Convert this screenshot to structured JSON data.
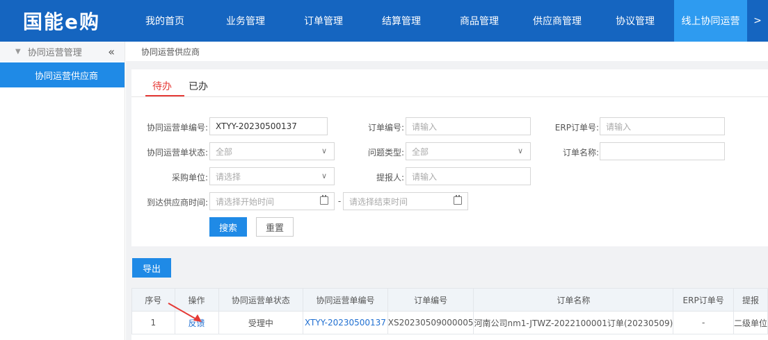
{
  "brand": {
    "logo_text": "国能e购"
  },
  "nav": {
    "items": [
      "我的首页",
      "业务管理",
      "订单管理",
      "结算管理",
      "商品管理",
      "供应商管理",
      "协议管理",
      "线上协同运营"
    ],
    "more": ">"
  },
  "sidebar": {
    "group_label": "协同运营管理",
    "collapse_icon": "«",
    "item": "协同运营供应商"
  },
  "breadcrumb": "协同运营供应商",
  "tabs": [
    "待办",
    "已办"
  ],
  "form": {
    "order_no_label": "协同运营单编号:",
    "order_no_value": "XTYY-20230500137",
    "order_id_label": "订单编号:",
    "order_id_placeholder": "请输入",
    "erp_label": "ERP订单号:",
    "erp_placeholder": "请输入",
    "status_label": "协同运营单状态:",
    "status_value": "全部",
    "issue_label": "问题类型:",
    "issue_value": "全部",
    "order_name_label": "订单名称:",
    "buyer_label": "采购单位:",
    "buyer_placeholder": "请选择",
    "reporter_label": "提报人:",
    "reporter_placeholder": "请输入",
    "arrive_label": "到达供应商时间:",
    "start_placeholder": "请选择开始时间",
    "range_sep": "-",
    "end_placeholder": "请选择结束时间",
    "search_btn": "搜索",
    "reset_btn": "重置"
  },
  "export_btn": "导出",
  "table": {
    "headers": [
      "序号",
      "操作",
      "协同运营单状态",
      "协同运营单编号",
      "订单编号",
      "订单名称",
      "ERP订单号",
      "提报"
    ],
    "rows": [
      [
        "1",
        "反馈",
        "受理中",
        "XTYY-20230500137",
        "XS20230509000005",
        "河南公司nm1-JTWZ-2022100001订单(20230509)",
        "-",
        "二级单位"
      ]
    ]
  }
}
